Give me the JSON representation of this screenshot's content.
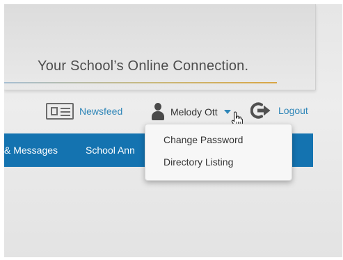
{
  "banner": {
    "tagline": "Your School’s Online Connection."
  },
  "userbar": {
    "newsfeed": {
      "label": "Newsfeed",
      "icon": "newspaper-icon"
    },
    "user": {
      "name": "Melody Ott",
      "icon": "person-icon",
      "caret": "caret-down-icon"
    },
    "logout": {
      "label": "Logout",
      "icon": "logout-icon"
    },
    "link_color": "#2f86b8"
  },
  "dropdown": {
    "items": [
      {
        "label": "Change Password"
      },
      {
        "label": "Directory Listing"
      }
    ]
  },
  "nav": {
    "background": "#1473b0",
    "items": [
      {
        "label": "& Messages"
      },
      {
        "label": "School Ann"
      }
    ]
  }
}
